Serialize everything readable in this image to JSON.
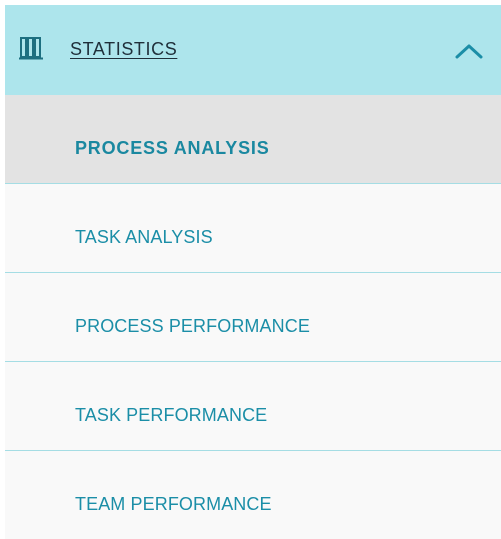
{
  "colors": {
    "header_bg": "#ade5ec",
    "accent_text": "#1b8ea7",
    "active_item_bg": "#e3e3e3",
    "item_bg": "#f9f9f9",
    "divider": "#a5dde4"
  },
  "section": {
    "icon": "bar-chart-icon",
    "title": "STATISTICS",
    "expanded": true,
    "toggle_icon": "chevron-up-icon"
  },
  "menu": {
    "items": [
      {
        "label": "PROCESS ANALYSIS",
        "active": true
      },
      {
        "label": "TASK ANALYSIS",
        "active": false
      },
      {
        "label": "PROCESS PERFORMANCE",
        "active": false
      },
      {
        "label": "TASK PERFORMANCE",
        "active": false
      },
      {
        "label": "TEAM PERFORMANCE",
        "active": false
      }
    ]
  }
}
